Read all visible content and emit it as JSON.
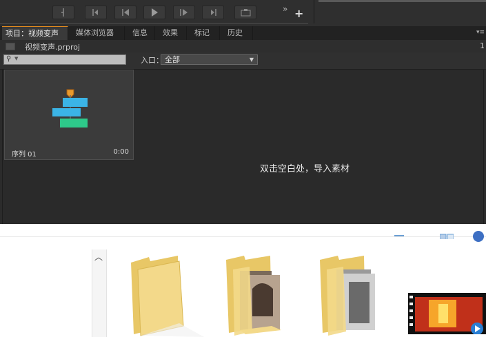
{
  "premiere": {
    "tabs": [
      {
        "label": "项目：视频变声",
        "close": "×"
      },
      {
        "label": "媒体浏览器"
      },
      {
        "label": "信息"
      },
      {
        "label": "效果"
      },
      {
        "label": "标记"
      },
      {
        "label": "历史"
      }
    ],
    "project_file": "视频变声.prproj",
    "item_count": "1",
    "entry_label": "入口：",
    "entry_value": "全部",
    "sequence": {
      "name": "序列 01",
      "duration": "0:00"
    },
    "empty_hint": "双击空白处，导入素材",
    "colors": {
      "accent": "#e08a1e",
      "seq_cyan": "#3bb4e6",
      "seq_green": "#2ec98a"
    }
  },
  "explorer": {
    "icons": [
      "folder-icon",
      "folder-photos-icon",
      "folder-photos-icon",
      "video-thumbnail-icon"
    ]
  }
}
